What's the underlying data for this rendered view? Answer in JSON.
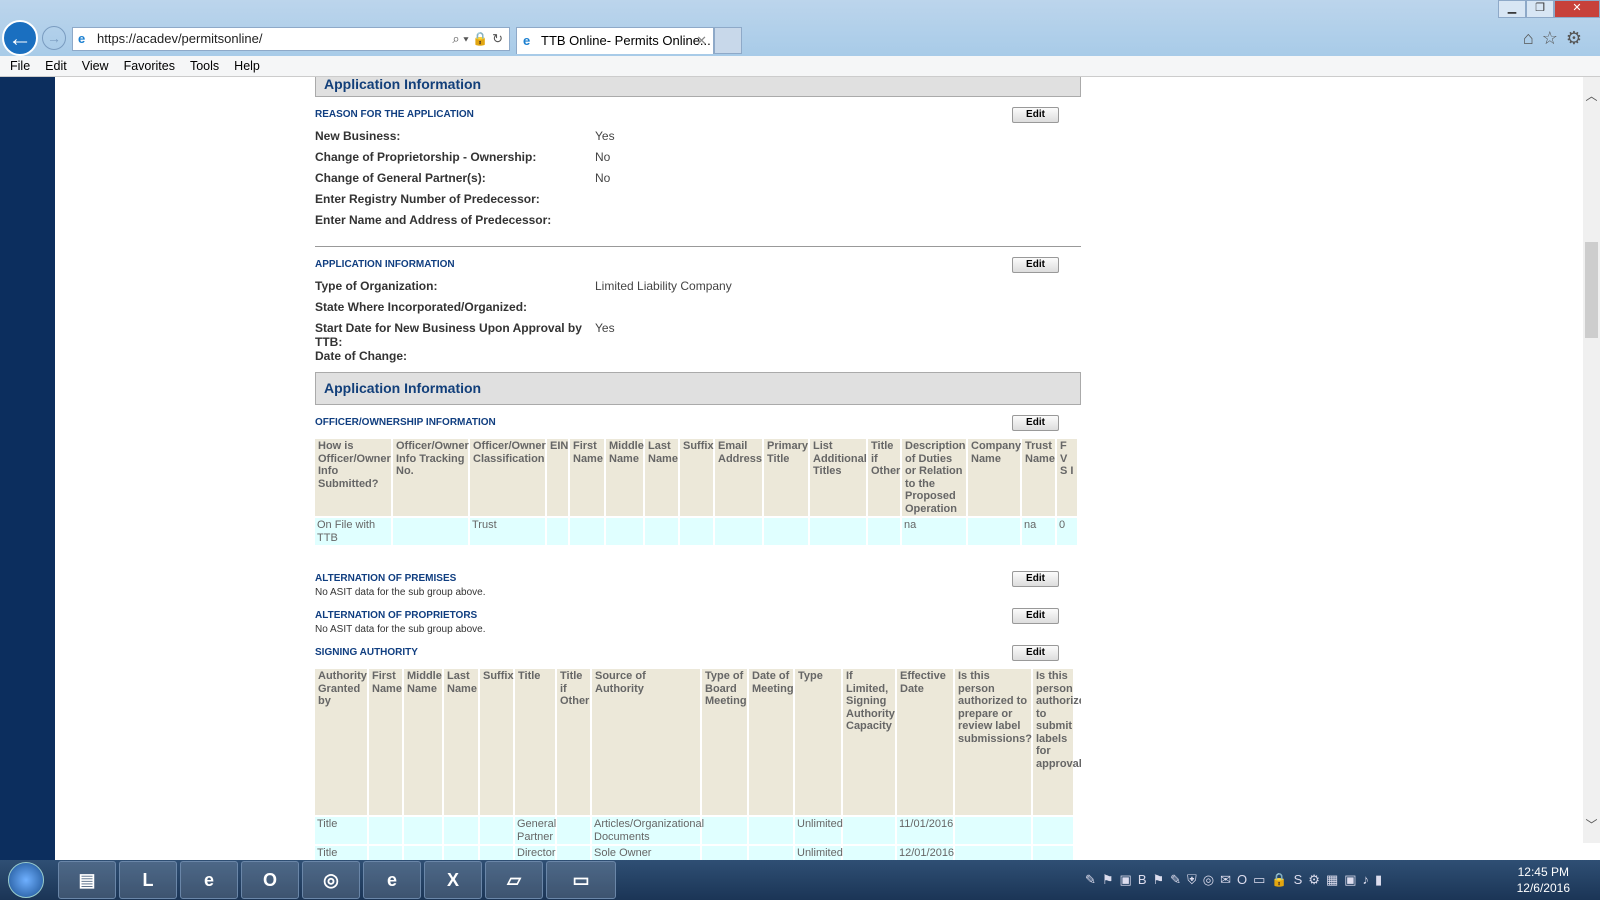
{
  "browser": {
    "url": "https://acadev/permitsonline/",
    "tab_title": "TTB Online- Permits Online...",
    "menu": [
      "File",
      "Edit",
      "View",
      "Favorites",
      "Tools",
      "Help"
    ]
  },
  "page": {
    "header1": "Application Information",
    "reason": {
      "title": "REASON FOR THE APPLICATION",
      "edit": "Edit",
      "rows": [
        {
          "label": "New Business:",
          "value": "Yes"
        },
        {
          "label": "Change of Proprietorship - Ownership:",
          "value": "No"
        },
        {
          "label": "Change of General Partner(s):",
          "value": "No"
        },
        {
          "label": "Enter Registry Number of Predecessor:",
          "value": ""
        },
        {
          "label": "Enter Name and Address of Predecessor:",
          "value": ""
        }
      ]
    },
    "appinfo": {
      "title": "APPLICATION INFORMATION",
      "edit": "Edit",
      "rows": [
        {
          "label": "Type of Organization:",
          "value": "Limited Liability Company"
        },
        {
          "label": "State Where Incorporated/Organized:",
          "value": ""
        },
        {
          "label": "Start Date for New Business Upon Approval by TTB:",
          "value": "Yes"
        },
        {
          "label": "Date of Change:",
          "value": ""
        }
      ]
    },
    "header2": "Application Information",
    "officer": {
      "title": "OFFICER/OWNERSHIP INFORMATION",
      "edit": "Edit",
      "columns": [
        "How is Officer/Owner Info Submitted?",
        "Officer/Owner Info Tracking No.",
        "Officer/Owner Classification",
        "EIN",
        "First Name",
        "Middle Name",
        "Last Name",
        "Suffix",
        "Email Address",
        "Primary Title",
        "List Additional Titles",
        "Title if Other",
        "Description of Duties or Relation to the Proposed Operation",
        "Company Name",
        "Trust Name",
        "F V S I"
      ],
      "rows": [
        [
          "On File with TTB",
          "",
          "Trust",
          "",
          "",
          "",
          "",
          "",
          "",
          "",
          "",
          "",
          "na",
          "",
          "na",
          "0"
        ]
      ]
    },
    "premises": {
      "title": "ALTERNATION OF PREMISES",
      "edit": "Edit",
      "note": "No ASIT data for the sub group above."
    },
    "proprietors": {
      "title": "ALTERNATION OF PROPRIETORS",
      "edit": "Edit",
      "note": "No ASIT data for the sub group above."
    },
    "signing": {
      "title": "SIGNING AUTHORITY",
      "edit": "Edit",
      "columns": [
        "Authority Granted by",
        "First Name",
        "Middle Name",
        "Last Name",
        "Suffix",
        "Title",
        "Title if Other",
        "Source of Authority",
        "Type of Board Meeting",
        "Date of Meeting",
        "Type",
        "If Limited, Signing Authority Capacity",
        "Effective Date",
        "Is this person authorized to prepare or review label submissions?",
        "Is this person authorized to submit labels for approval"
      ],
      "rows": [
        [
          "Title",
          "",
          "",
          "",
          "",
          "General Partner",
          "",
          "Articles/Organizational Documents",
          "",
          "",
          "Unlimited",
          "",
          "11/01/2016",
          "",
          ""
        ],
        [
          "Title",
          "",
          "",
          "",
          "",
          "Director",
          "",
          "Sole Owner",
          "",
          "",
          "Unlimited",
          "",
          "12/01/2016",
          "",
          ""
        ]
      ]
    }
  },
  "taskbar": {
    "time": "12:45 PM",
    "date": "12/6/2016"
  }
}
